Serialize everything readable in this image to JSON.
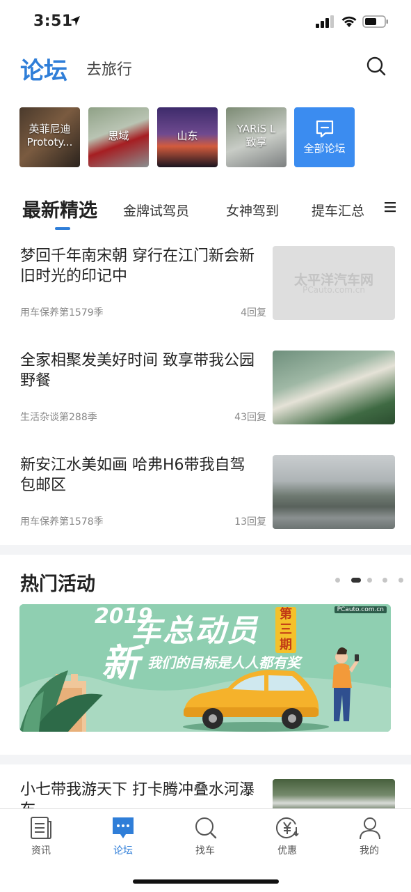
{
  "status_bar": {
    "time": "3:51"
  },
  "header": {
    "active_label": "论坛",
    "secondary_label": "去旅行"
  },
  "forums": [
    {
      "label": "英菲尼迪\nPrototy..."
    },
    {
      "label": "思域"
    },
    {
      "label": "山东"
    },
    {
      "label": "YARiS L\n致享"
    },
    {
      "label": "全部论坛"
    }
  ],
  "tabs": {
    "active": "最新精选",
    "items": [
      "金牌试驾员",
      "女神驾到",
      "提车汇总"
    ]
  },
  "articles": [
    {
      "title": "梦回千年南宋朝 穿行在江门新会新旧时光的印记中",
      "meta": "用车保养第1579季",
      "replies": "4回复",
      "watermark": "太平洋汽车网",
      "watermark_url": "PCauto.com.cn"
    },
    {
      "title": "全家相聚发美好时间 致享带我公园野餐",
      "meta": "生活杂谈第288季",
      "replies": "43回复"
    },
    {
      "title": "新安江水美如画 哈弗H6带我自驾包邮区",
      "meta": "用车保养第1578季",
      "replies": "13回复"
    }
  ],
  "hot": {
    "title": "热门活动",
    "banner": {
      "year": "2019",
      "head": "车总动员",
      "issue": "第三期",
      "big": "新",
      "sub": "我们的目标是人人都有奖",
      "brand": "PCauto.com.cn"
    }
  },
  "article_partial": {
    "title": "小七带我游天下 打卡腾冲叠水河瀑布"
  },
  "tabbar": {
    "items": [
      {
        "label": "资讯"
      },
      {
        "label": "论坛"
      },
      {
        "label": "找车"
      },
      {
        "label": "优惠"
      },
      {
        "label": "我的"
      }
    ],
    "active_index": 1
  },
  "colors": {
    "accent": "#2f7ed8",
    "forum_all_bg": "#3b8cf0"
  }
}
